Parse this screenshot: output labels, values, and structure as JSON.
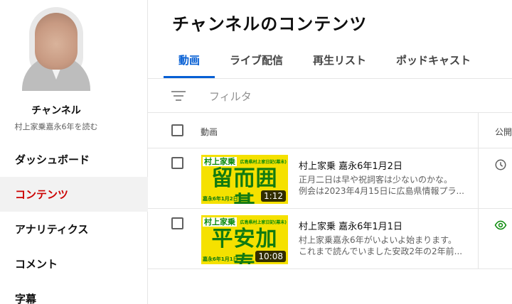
{
  "channel": {
    "name": "チャンネル",
    "subtitle": "村上家乗嘉永6年を読む"
  },
  "sidebar": {
    "items": [
      {
        "label": "ダッシュボード",
        "active": false
      },
      {
        "label": "コンテンツ",
        "active": true
      },
      {
        "label": "アナリティクス",
        "active": false
      },
      {
        "label": "コメント",
        "active": false
      },
      {
        "label": "字幕",
        "active": false
      }
    ]
  },
  "main": {
    "title": "チャンネルのコンテンツ",
    "tabs": [
      {
        "label": "動画",
        "active": true
      },
      {
        "label": "ライブ配信",
        "active": false
      },
      {
        "label": "再生リスト",
        "active": false
      },
      {
        "label": "ポッドキャスト",
        "active": false
      }
    ],
    "filter_label": "フィルタ",
    "columns": {
      "video": "動画",
      "visibility": "公開"
    }
  },
  "videos": [
    {
      "thumb_badge": "村上家乗",
      "thumb_badge_side": "広島県村上家日記(幕末)",
      "thumb_text": "留而囲碁",
      "thumb_date": "嘉永6年1月2日",
      "duration": "1:12",
      "title": "村上家乗 嘉永6年1月2日",
      "desc_line1": "正月二日は早や祝詞客は少ないのかな。",
      "desc_line2": "例会は2023年4月15日に広島県情報プラ...",
      "visibility_icon": "clock-icon"
    },
    {
      "thumb_badge": "村上家乗",
      "thumb_badge_side": "広島県村上家日記(幕末)",
      "thumb_text": "平安加寿",
      "thumb_date": "嘉永6年1月1日",
      "duration": "10:08",
      "title": "村上家乗 嘉永6年1月1日",
      "desc_line1": "村上家乗嘉永6年がいよいよ始まります。",
      "desc_line2": "これまで読んでいました安政2年の2年前...",
      "visibility_icon": "eye-icon"
    }
  ],
  "colors": {
    "accent": "#065fd4",
    "active_nav": "#cc0000",
    "thumb_bg": "#f5e100",
    "thumb_text": "#117a11",
    "eye_green": "#0a8a0a"
  }
}
